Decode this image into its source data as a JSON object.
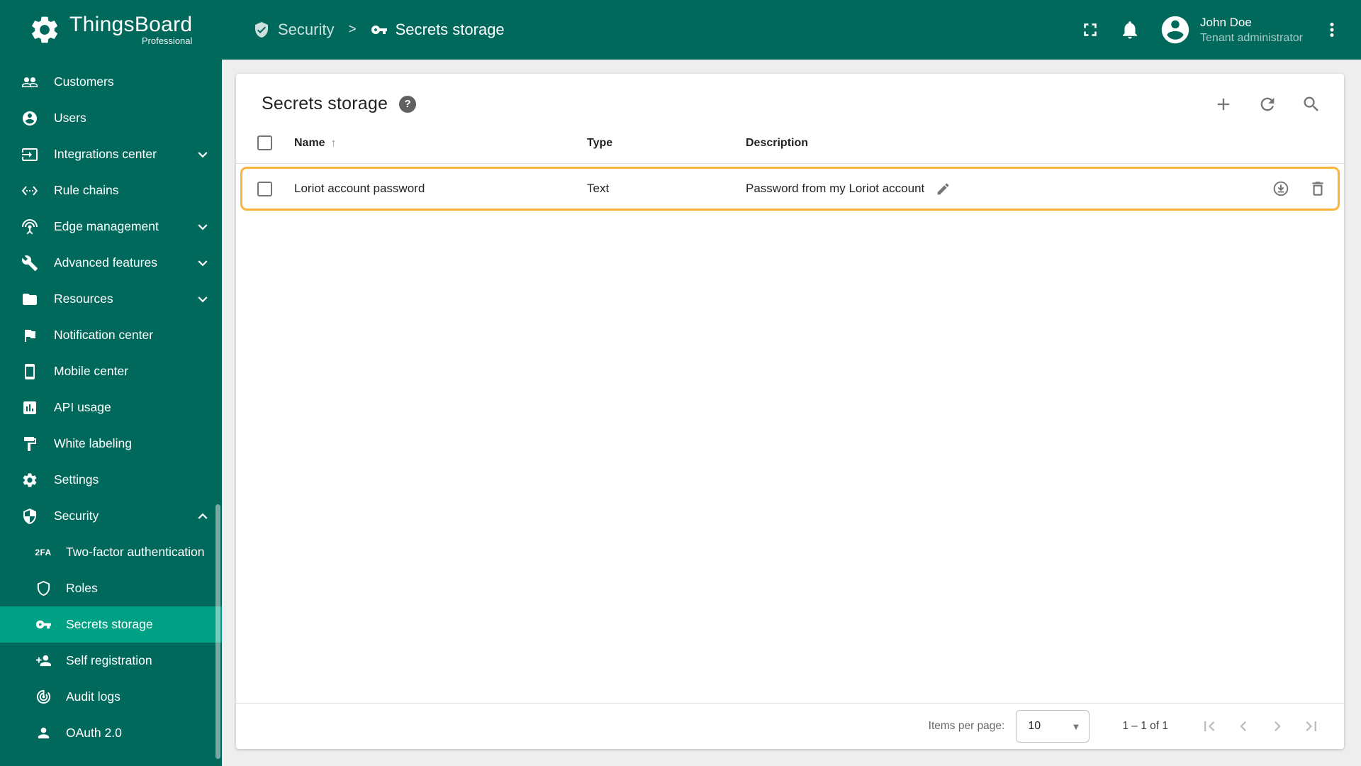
{
  "colors": {
    "primary": "#00695c",
    "sidebar_selected": "#00a184",
    "row_highlight_border": "#f9b43b",
    "content_background": "#eeeeee"
  },
  "topbar": {
    "app_name": "ThingsBoard",
    "edition": "Professional",
    "breadcrumb": {
      "section": "Security",
      "separator": ">",
      "page": "Secrets storage"
    },
    "user": {
      "name": "John Doe",
      "role": "Tenant administrator"
    }
  },
  "sidebar": {
    "items": [
      {
        "label": "Customers"
      },
      {
        "label": "Users"
      },
      {
        "label": "Integrations center"
      },
      {
        "label": "Rule chains"
      },
      {
        "label": "Edge management"
      },
      {
        "label": "Advanced features"
      },
      {
        "label": "Resources"
      },
      {
        "label": "Notification center"
      },
      {
        "label": "Mobile center"
      },
      {
        "label": "API usage"
      },
      {
        "label": "White labeling"
      },
      {
        "label": "Settings"
      },
      {
        "label": "Security"
      }
    ],
    "security_subitems": [
      {
        "label": "Two-factor authentication"
      },
      {
        "label": "Roles"
      },
      {
        "label": "Secrets storage"
      },
      {
        "label": "Self registration"
      },
      {
        "label": "Audit logs"
      },
      {
        "label": "OAuth 2.0"
      }
    ]
  },
  "page": {
    "title": "Secrets storage",
    "table": {
      "headers": {
        "name": "Name",
        "type": "Type",
        "description": "Description"
      },
      "rows": [
        {
          "name": "Loriot account password",
          "type": "Text",
          "description": "Password from my Loriot account"
        }
      ]
    },
    "pagination": {
      "items_per_page_label": "Items per page:",
      "page_size": "10",
      "range": "1 – 1 of 1"
    }
  },
  "glyphs": {
    "sort_asc": "↑",
    "dropdown_caret": "▼",
    "two_fa": "2FA",
    "help": "?"
  }
}
